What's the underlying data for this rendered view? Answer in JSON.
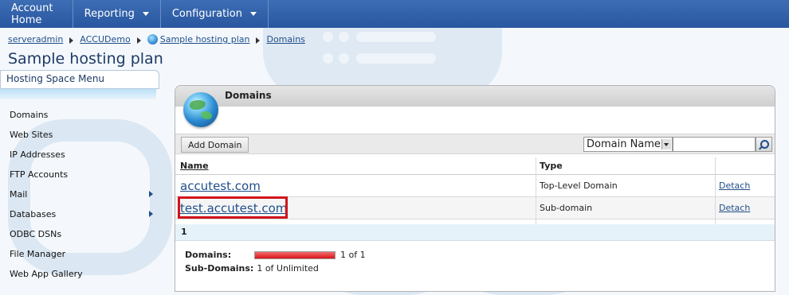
{
  "topnav": {
    "items": [
      {
        "label": "Account Home",
        "dropdown": false
      },
      {
        "label": "Reporting",
        "dropdown": true
      },
      {
        "label": "Configuration",
        "dropdown": true
      }
    ]
  },
  "breadcrumb": [
    "serveradmin",
    "ACCUDemo",
    "Sample hosting plan",
    "Domains"
  ],
  "page": {
    "title": "Sample hosting plan"
  },
  "sidebar": {
    "title": "Hosting Space Menu",
    "items": [
      {
        "label": "Domains",
        "submenu": false
      },
      {
        "label": "Web Sites",
        "submenu": false
      },
      {
        "label": "IP Addresses",
        "submenu": false
      },
      {
        "label": "FTP Accounts",
        "submenu": false
      },
      {
        "label": "Mail",
        "submenu": true
      },
      {
        "label": "Databases",
        "submenu": true
      },
      {
        "label": "ODBC DSNs",
        "submenu": false
      },
      {
        "label": "File Manager",
        "submenu": false
      },
      {
        "label": "Web App Gallery",
        "submenu": false
      }
    ]
  },
  "panel": {
    "title": "Domains",
    "add_button": "Add Domain",
    "search": {
      "field": "Domain Name",
      "value": ""
    },
    "columns": [
      "Name",
      "Type"
    ],
    "rows": [
      {
        "name": "accutest.com",
        "type": "Top-Level Domain",
        "action": "Detach"
      },
      {
        "name": "test.accutest.com",
        "type": "Sub-domain",
        "action": "Detach"
      }
    ],
    "pager": "1",
    "quota": {
      "domains_label": "Domains:",
      "domains_text": "1 of 1",
      "domains_usage": 1.0,
      "subdomains_label": "Sub-Domains:",
      "subdomains_text": "1 of Unlimited"
    }
  },
  "colors": {
    "nav": "#2f5fa8",
    "link": "#1f4e8a",
    "highlight": "#d0141b",
    "quota_fill": "#d8141b"
  }
}
